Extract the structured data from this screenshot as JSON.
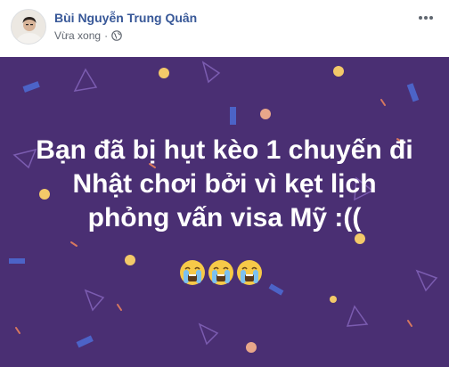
{
  "post": {
    "author_name": "Bùi Nguyễn Trung Quân",
    "timestamp": "Vừa xong",
    "separator": "·",
    "privacy_icon": "globe-icon",
    "more_icon": "more-options-icon"
  },
  "status_card": {
    "background_color": "#4a2f73",
    "lines": [
      "Bạn đã bị hụt kèo 1 chuyến đi",
      "Nhật chơi bởi vì kẹt lịch",
      "phỏng vấn visa Mỹ :(("
    ],
    "emoji": [
      "loudly-crying-face",
      "loudly-crying-face",
      "loudly-crying-face"
    ],
    "text_color": "#ffffff"
  }
}
